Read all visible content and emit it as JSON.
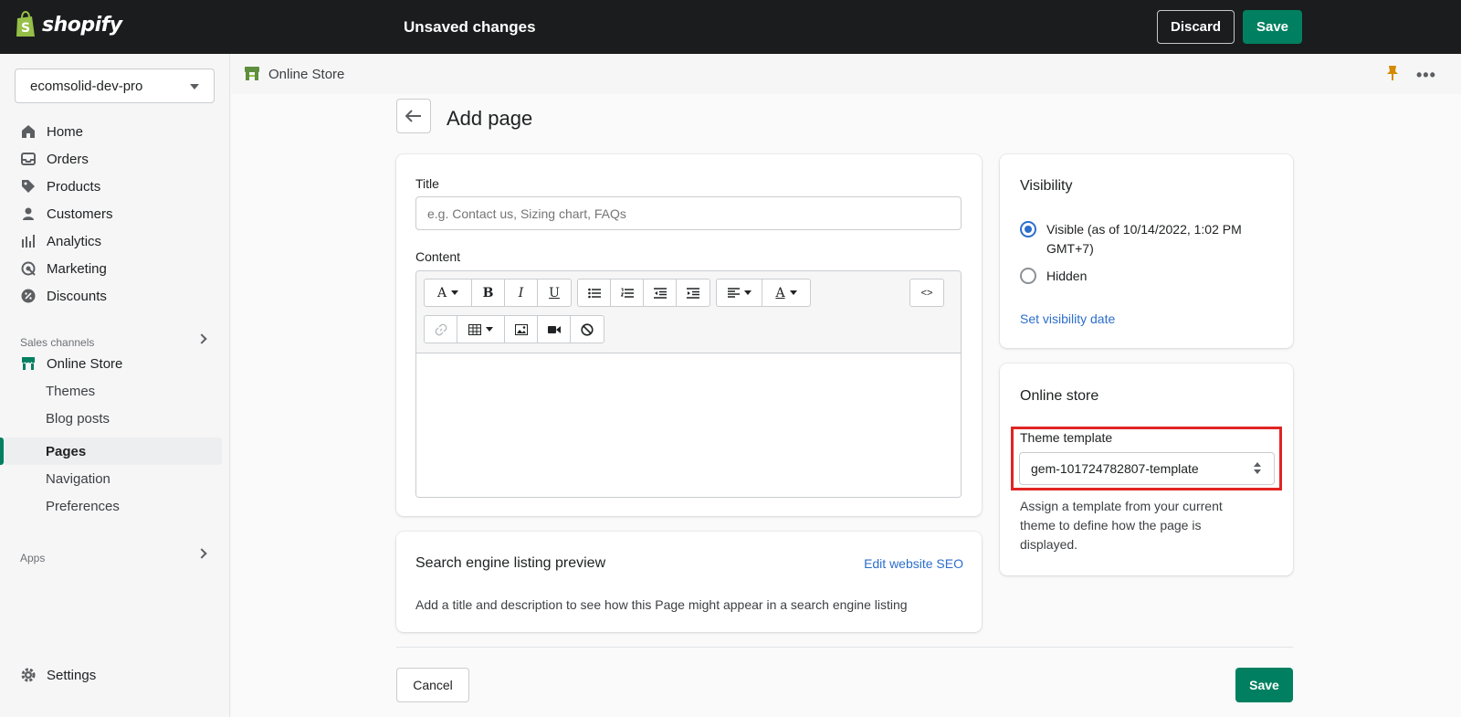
{
  "topbar": {
    "brand": "shopify",
    "status": "Unsaved changes",
    "discard_label": "Discard",
    "save_label": "Save"
  },
  "sidebar": {
    "store_name": "ecomsolid-dev-pro",
    "items": [
      {
        "label": "Home",
        "icon": "home-icon"
      },
      {
        "label": "Orders",
        "icon": "orders-icon"
      },
      {
        "label": "Products",
        "icon": "tag-icon"
      },
      {
        "label": "Customers",
        "icon": "person-icon"
      },
      {
        "label": "Analytics",
        "icon": "bar-chart-icon"
      },
      {
        "label": "Marketing",
        "icon": "target-icon"
      },
      {
        "label": "Discounts",
        "icon": "discount-icon"
      }
    ],
    "sales_channels_label": "Sales channels",
    "online_store_label": "Online Store",
    "sub_items": [
      "Themes",
      "Blog posts",
      "Pages",
      "Navigation",
      "Preferences"
    ],
    "active_sub_item": "Pages",
    "apps_label": "Apps",
    "settings_label": "Settings"
  },
  "breadcrumb": {
    "label": "Online Store"
  },
  "page": {
    "title": "Add page",
    "title_field": {
      "label": "Title",
      "placeholder": "e.g. Contact us, Sizing chart, FAQs",
      "value": ""
    },
    "content_label": "Content",
    "toolbar": {
      "font_label": "A",
      "bold_label": "B",
      "italic_label": "I",
      "underline_label": "U",
      "color_label": "A",
      "source_label": "<>"
    },
    "seo": {
      "title": "Search engine listing preview",
      "edit_link": "Edit website SEO",
      "description": "Add a title and description to see how this Page might appear in a search engine listing"
    },
    "visibility": {
      "title": "Visibility",
      "options": [
        {
          "label": "Visible (as of 10/14/2022, 1:02 PM",
          "label_line2": "GMT+7)",
          "checked": true
        },
        {
          "label": "Hidden",
          "checked": false
        }
      ],
      "set_date_link": "Set visibility date"
    },
    "online_store": {
      "title": "Online store",
      "template_label": "Theme template",
      "template_value": "gem-101724782807-template",
      "help_line1": "Assign a template from your current",
      "help_line2": "theme to define how the page is",
      "help_line3": "displayed."
    },
    "cancel_label": "Cancel",
    "save_label": "Save"
  },
  "colors": {
    "accent": "#008060",
    "link": "#2c6ecb",
    "highlight": "#e02424",
    "topbar": "#1a1c1d"
  }
}
